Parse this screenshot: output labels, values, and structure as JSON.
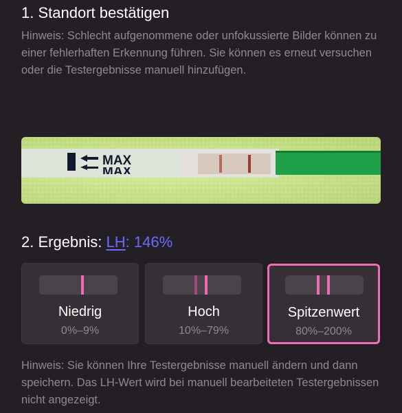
{
  "step1": {
    "title": "1. Standort bestätigen",
    "hint": "Hinweis: Schlecht aufgenommene oder unfokussierte Bilder können zu einer fehlerhaften Erkennung führen. Sie können es erneut versuchen oder die Testergebnisse manuell hinzufügen."
  },
  "strip": {
    "max_label": "MAX",
    "colors": {
      "background": "#c9e28a",
      "strip": "#dde2d8",
      "control_line": "#b4574a",
      "handle": "#1fa14a"
    }
  },
  "result": {
    "prefix": "2. Ergebnis: ",
    "hormone": "LH",
    "colon": ":",
    "value": "146%",
    "accent": "#6a6cff"
  },
  "levels": [
    {
      "label": "Niedrig",
      "range": "0%–9%",
      "lines": 1,
      "selected": false
    },
    {
      "label": "Hoch",
      "range": "10%–79%",
      "lines": 2,
      "selected": false
    },
    {
      "label": "Spitzenwert",
      "range": "80%–200%",
      "lines": 2,
      "selected": true
    }
  ],
  "bottom_hint": "Hinweis: Sie können Ihre Testergebnisse manuell ändern und dann speichern. Das LH-Wert wird bei manuell bearbeiteten Testergebnissen nicht angezeigt.",
  "colors": {
    "background": "#241f24",
    "card": "#363036",
    "selected_border": "#ee6fb8",
    "line": "#f06ab4",
    "muted_text": "#8f8a8f"
  }
}
